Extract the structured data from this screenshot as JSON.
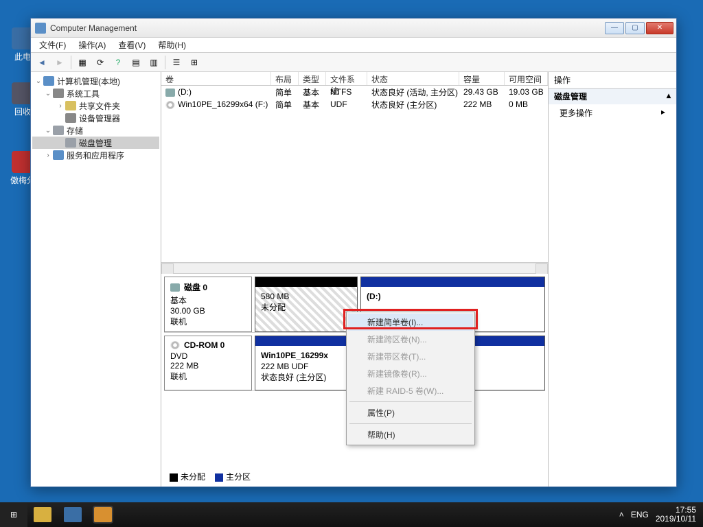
{
  "desktop": {
    "icons": [
      {
        "label": "此电"
      },
      {
        "label": "回收"
      },
      {
        "label": "傲梅分"
      }
    ]
  },
  "window": {
    "title": "Computer Management",
    "win_min": "—",
    "win_max": "▢",
    "win_close": "✕"
  },
  "menubar": {
    "file": "文件(F)",
    "action": "操作(A)",
    "view": "查看(V)",
    "help": "帮助(H)"
  },
  "tree": {
    "root": "计算机管理(本地)",
    "systools": "系统工具",
    "shared": "共享文件夹",
    "devmgr": "设备管理器",
    "storage": "存储",
    "diskmgmt": "磁盘管理",
    "services": "服务和应用程序"
  },
  "listcols": {
    "vol": "卷",
    "layout": "布局",
    "type": "类型",
    "fs": "文件系统",
    "status": "状态",
    "capacity": "容量",
    "free": "可用空间"
  },
  "volumes": [
    {
      "name": "(D:)",
      "layout": "简单",
      "type": "基本",
      "fs": "NTFS",
      "status": "状态良好 (活动, 主分区)",
      "capacity": "29.43 GB",
      "free": "19.03 GB",
      "icon": "hdd"
    },
    {
      "name": "Win10PE_16299x64 (F:)",
      "layout": "简单",
      "type": "基本",
      "fs": "UDF",
      "status": "状态良好 (主分区)",
      "capacity": "222 MB",
      "free": "0 MB",
      "icon": "cd"
    }
  ],
  "disks": {
    "disk0": {
      "title": "磁盘 0",
      "type": "基本",
      "size": "30.00 GB",
      "state": "联机",
      "part_unalloc_size": "580 MB",
      "part_unalloc_state": "未分配",
      "part_d_label": "(D:)"
    },
    "cdrom0": {
      "title": "CD-ROM 0",
      "type": "DVD",
      "size": "222 MB",
      "state": "联机",
      "vol_label": "Win10PE_16299x",
      "vol_size": "222 MB UDF",
      "vol_status": "状态良好 (主分区)"
    }
  },
  "legend": {
    "unalloc": "未分配",
    "primary": "主分区"
  },
  "actions": {
    "header": "操作",
    "section": "磁盘管理",
    "more": "更多操作",
    "caret_up": "▴",
    "caret_right": "▸"
  },
  "context": {
    "new_simple": "新建简单卷(I)...",
    "new_span": "新建跨区卷(N)...",
    "new_stripe": "新建带区卷(T)...",
    "new_mirror": "新建镜像卷(R)...",
    "new_raid5": "新建 RAID-5 卷(W)...",
    "properties": "属性(P)",
    "help": "帮助(H)"
  },
  "taskbar": {
    "lang": "ENG",
    "tray_caret": "˄",
    "time": "17:55",
    "date": "2019/10/11"
  },
  "glyph": {
    "expand_open": "⌄",
    "expand_closed": "›",
    "back": "◄",
    "fwd": "►"
  }
}
